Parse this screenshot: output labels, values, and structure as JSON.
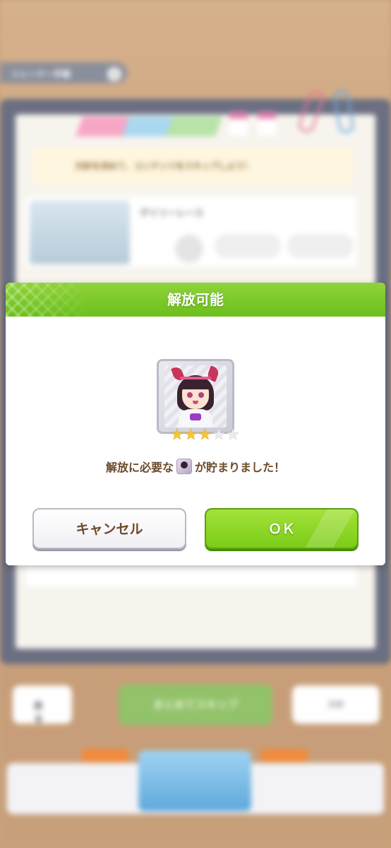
{
  "background": {
    "header_title": "トレーナー手帳",
    "header_badge": "i",
    "banner_text": "方針を決めて、コンテンツをスキップしよう！",
    "row_title": "デイリーレース",
    "back_label": "戻る",
    "skip_all_label": "まとめてスキップ",
    "right_label": "方針"
  },
  "dialog": {
    "title": "解放可能",
    "rarity_stars": {
      "filled": 3,
      "total": 5
    },
    "message_before": "解放に必要な",
    "message_icon": "character-piece-icon",
    "message_after": "が貯まりました！",
    "cancel_label": "キャンセル",
    "ok_label": "ＯＫ"
  },
  "colors": {
    "header_green": "#7cc620",
    "ok_green": "#8ed62a",
    "text_brown": "#6b4a2a",
    "star_gold": "#f7c52b"
  }
}
